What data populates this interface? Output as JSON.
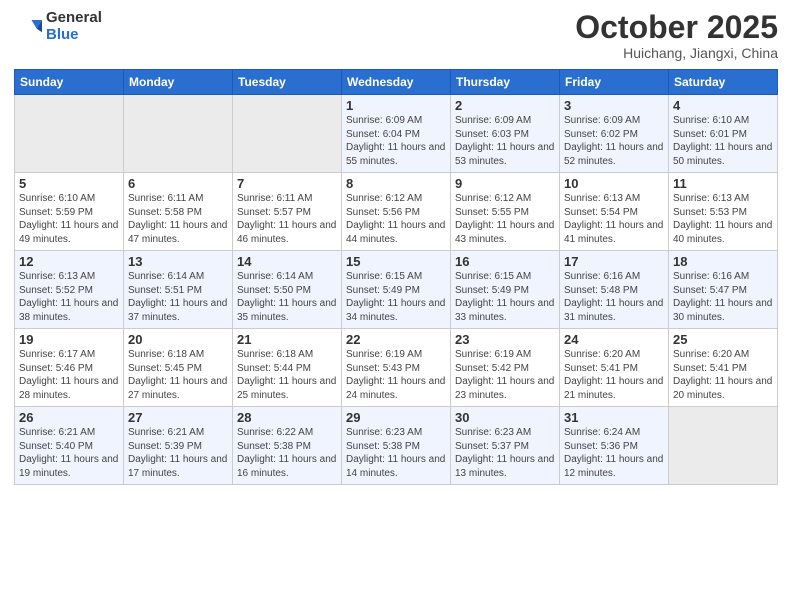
{
  "header": {
    "logo_general": "General",
    "logo_blue": "Blue",
    "month": "October 2025",
    "location": "Huichang, Jiangxi, China"
  },
  "weekdays": [
    "Sunday",
    "Monday",
    "Tuesday",
    "Wednesday",
    "Thursday",
    "Friday",
    "Saturday"
  ],
  "weeks": [
    [
      {
        "day": "",
        "empty": true
      },
      {
        "day": "",
        "empty": true
      },
      {
        "day": "",
        "empty": true
      },
      {
        "day": "1",
        "sunrise": "6:09 AM",
        "sunset": "6:04 PM",
        "daylight": "11 hours and 55 minutes."
      },
      {
        "day": "2",
        "sunrise": "6:09 AM",
        "sunset": "6:03 PM",
        "daylight": "11 hours and 53 minutes."
      },
      {
        "day": "3",
        "sunrise": "6:09 AM",
        "sunset": "6:02 PM",
        "daylight": "11 hours and 52 minutes."
      },
      {
        "day": "4",
        "sunrise": "6:10 AM",
        "sunset": "6:01 PM",
        "daylight": "11 hours and 50 minutes."
      }
    ],
    [
      {
        "day": "5",
        "sunrise": "6:10 AM",
        "sunset": "5:59 PM",
        "daylight": "11 hours and 49 minutes."
      },
      {
        "day": "6",
        "sunrise": "6:11 AM",
        "sunset": "5:58 PM",
        "daylight": "11 hours and 47 minutes."
      },
      {
        "day": "7",
        "sunrise": "6:11 AM",
        "sunset": "5:57 PM",
        "daylight": "11 hours and 46 minutes."
      },
      {
        "day": "8",
        "sunrise": "6:12 AM",
        "sunset": "5:56 PM",
        "daylight": "11 hours and 44 minutes."
      },
      {
        "day": "9",
        "sunrise": "6:12 AM",
        "sunset": "5:55 PM",
        "daylight": "11 hours and 43 minutes."
      },
      {
        "day": "10",
        "sunrise": "6:13 AM",
        "sunset": "5:54 PM",
        "daylight": "11 hours and 41 minutes."
      },
      {
        "day": "11",
        "sunrise": "6:13 AM",
        "sunset": "5:53 PM",
        "daylight": "11 hours and 40 minutes."
      }
    ],
    [
      {
        "day": "12",
        "sunrise": "6:13 AM",
        "sunset": "5:52 PM",
        "daylight": "11 hours and 38 minutes."
      },
      {
        "day": "13",
        "sunrise": "6:14 AM",
        "sunset": "5:51 PM",
        "daylight": "11 hours and 37 minutes."
      },
      {
        "day": "14",
        "sunrise": "6:14 AM",
        "sunset": "5:50 PM",
        "daylight": "11 hours and 35 minutes."
      },
      {
        "day": "15",
        "sunrise": "6:15 AM",
        "sunset": "5:49 PM",
        "daylight": "11 hours and 34 minutes."
      },
      {
        "day": "16",
        "sunrise": "6:15 AM",
        "sunset": "5:49 PM",
        "daylight": "11 hours and 33 minutes."
      },
      {
        "day": "17",
        "sunrise": "6:16 AM",
        "sunset": "5:48 PM",
        "daylight": "11 hours and 31 minutes."
      },
      {
        "day": "18",
        "sunrise": "6:16 AM",
        "sunset": "5:47 PM",
        "daylight": "11 hours and 30 minutes."
      }
    ],
    [
      {
        "day": "19",
        "sunrise": "6:17 AM",
        "sunset": "5:46 PM",
        "daylight": "11 hours and 28 minutes."
      },
      {
        "day": "20",
        "sunrise": "6:18 AM",
        "sunset": "5:45 PM",
        "daylight": "11 hours and 27 minutes."
      },
      {
        "day": "21",
        "sunrise": "6:18 AM",
        "sunset": "5:44 PM",
        "daylight": "11 hours and 25 minutes."
      },
      {
        "day": "22",
        "sunrise": "6:19 AM",
        "sunset": "5:43 PM",
        "daylight": "11 hours and 24 minutes."
      },
      {
        "day": "23",
        "sunrise": "6:19 AM",
        "sunset": "5:42 PM",
        "daylight": "11 hours and 23 minutes."
      },
      {
        "day": "24",
        "sunrise": "6:20 AM",
        "sunset": "5:41 PM",
        "daylight": "11 hours and 21 minutes."
      },
      {
        "day": "25",
        "sunrise": "6:20 AM",
        "sunset": "5:41 PM",
        "daylight": "11 hours and 20 minutes."
      }
    ],
    [
      {
        "day": "26",
        "sunrise": "6:21 AM",
        "sunset": "5:40 PM",
        "daylight": "11 hours and 19 minutes."
      },
      {
        "day": "27",
        "sunrise": "6:21 AM",
        "sunset": "5:39 PM",
        "daylight": "11 hours and 17 minutes."
      },
      {
        "day": "28",
        "sunrise": "6:22 AM",
        "sunset": "5:38 PM",
        "daylight": "11 hours and 16 minutes."
      },
      {
        "day": "29",
        "sunrise": "6:23 AM",
        "sunset": "5:38 PM",
        "daylight": "11 hours and 14 minutes."
      },
      {
        "day": "30",
        "sunrise": "6:23 AM",
        "sunset": "5:37 PM",
        "daylight": "11 hours and 13 minutes."
      },
      {
        "day": "31",
        "sunrise": "6:24 AM",
        "sunset": "5:36 PM",
        "daylight": "11 hours and 12 minutes."
      },
      {
        "day": "",
        "empty": true
      }
    ]
  ]
}
